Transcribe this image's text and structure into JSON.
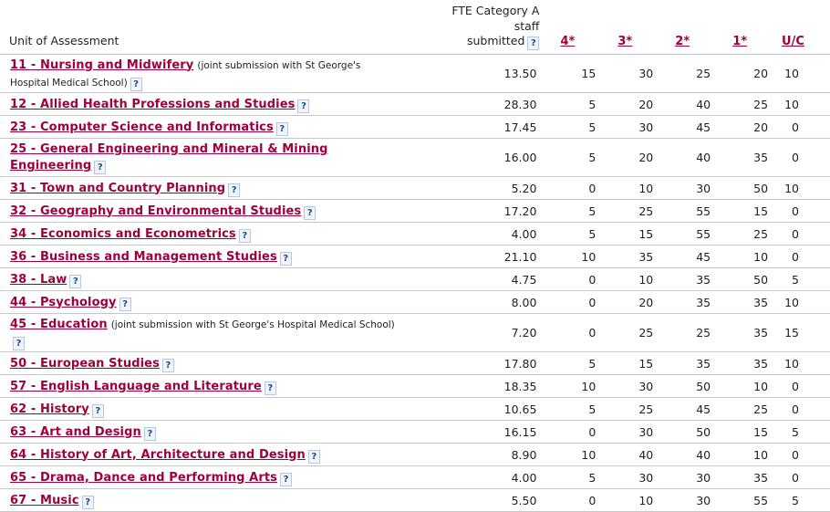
{
  "header": {
    "unit_label": "Unit of Assessment",
    "fte_line1": "FTE Category A",
    "fte_line2": "staff",
    "fte_line3": "submitted",
    "star4": "4*",
    "star3": "3*",
    "star2": "2*",
    "star1": "1*",
    "uc": "U/C",
    "help": "?"
  },
  "rows": [
    {
      "unit": "11 - Nursing and Midwifery",
      "note": "(joint submission with St George's Hospital Medical School)",
      "fte": "13.50",
      "s4": "15",
      "s3": "30",
      "s2": "25",
      "s1": "20",
      "uc": "10"
    },
    {
      "unit": "12 - Allied Health Professions and Studies",
      "note": "",
      "fte": "28.30",
      "s4": "5",
      "s3": "20",
      "s2": "40",
      "s1": "25",
      "uc": "10"
    },
    {
      "unit": "23 - Computer Science and Informatics",
      "note": "",
      "fte": "17.45",
      "s4": "5",
      "s3": "30",
      "s2": "45",
      "s1": "20",
      "uc": "0"
    },
    {
      "unit": "25 - General Engineering and Mineral & Mining Engineering",
      "note": "",
      "fte": "16.00",
      "s4": "5",
      "s3": "20",
      "s2": "40",
      "s1": "35",
      "uc": "0"
    },
    {
      "unit": "31 - Town and Country Planning",
      "note": "",
      "fte": "5.20",
      "s4": "0",
      "s3": "10",
      "s2": "30",
      "s1": "50",
      "uc": "10"
    },
    {
      "unit": "32 - Geography and Environmental Studies",
      "note": "",
      "fte": "17.20",
      "s4": "5",
      "s3": "25",
      "s2": "55",
      "s1": "15",
      "uc": "0"
    },
    {
      "unit": "34 - Economics and Econometrics",
      "note": "",
      "fte": "4.00",
      "s4": "5",
      "s3": "15",
      "s2": "55",
      "s1": "25",
      "uc": "0"
    },
    {
      "unit": "36 - Business and Management Studies",
      "note": "",
      "fte": "21.10",
      "s4": "10",
      "s3": "35",
      "s2": "45",
      "s1": "10",
      "uc": "0"
    },
    {
      "unit": "38 - Law",
      "note": "",
      "fte": "4.75",
      "s4": "0",
      "s3": "10",
      "s2": "35",
      "s1": "50",
      "uc": "5"
    },
    {
      "unit": "44 - Psychology",
      "note": "",
      "fte": "8.00",
      "s4": "0",
      "s3": "20",
      "s2": "35",
      "s1": "35",
      "uc": "10"
    },
    {
      "unit": "45 - Education",
      "note": "(joint submission with St George's Hospital Medical School)",
      "fte": "7.20",
      "s4": "0",
      "s3": "25",
      "s2": "25",
      "s1": "35",
      "uc": "15"
    },
    {
      "unit": "50 - European Studies",
      "note": "",
      "fte": "17.80",
      "s4": "5",
      "s3": "15",
      "s2": "35",
      "s1": "35",
      "uc": "10"
    },
    {
      "unit": "57 - English Language and Literature",
      "note": "",
      "fte": "18.35",
      "s4": "10",
      "s3": "30",
      "s2": "50",
      "s1": "10",
      "uc": "0"
    },
    {
      "unit": "62 - History",
      "note": "",
      "fte": "10.65",
      "s4": "5",
      "s3": "25",
      "s2": "45",
      "s1": "25",
      "uc": "0"
    },
    {
      "unit": "63 - Art and Design",
      "note": "",
      "fte": "16.15",
      "s4": "0",
      "s3": "30",
      "s2": "50",
      "s1": "15",
      "uc": "5"
    },
    {
      "unit": "64 - History of Art, Architecture and Design",
      "note": "",
      "fte": "8.90",
      "s4": "10",
      "s3": "40",
      "s2": "40",
      "s1": "10",
      "uc": "0"
    },
    {
      "unit": "65 - Drama, Dance and Performing Arts",
      "note": "",
      "fte": "4.00",
      "s4": "5",
      "s3": "30",
      "s2": "30",
      "s1": "35",
      "uc": "0"
    },
    {
      "unit": "67 - Music",
      "note": "",
      "fte": "5.50",
      "s4": "0",
      "s3": "10",
      "s2": "30",
      "s1": "55",
      "uc": "5"
    }
  ]
}
